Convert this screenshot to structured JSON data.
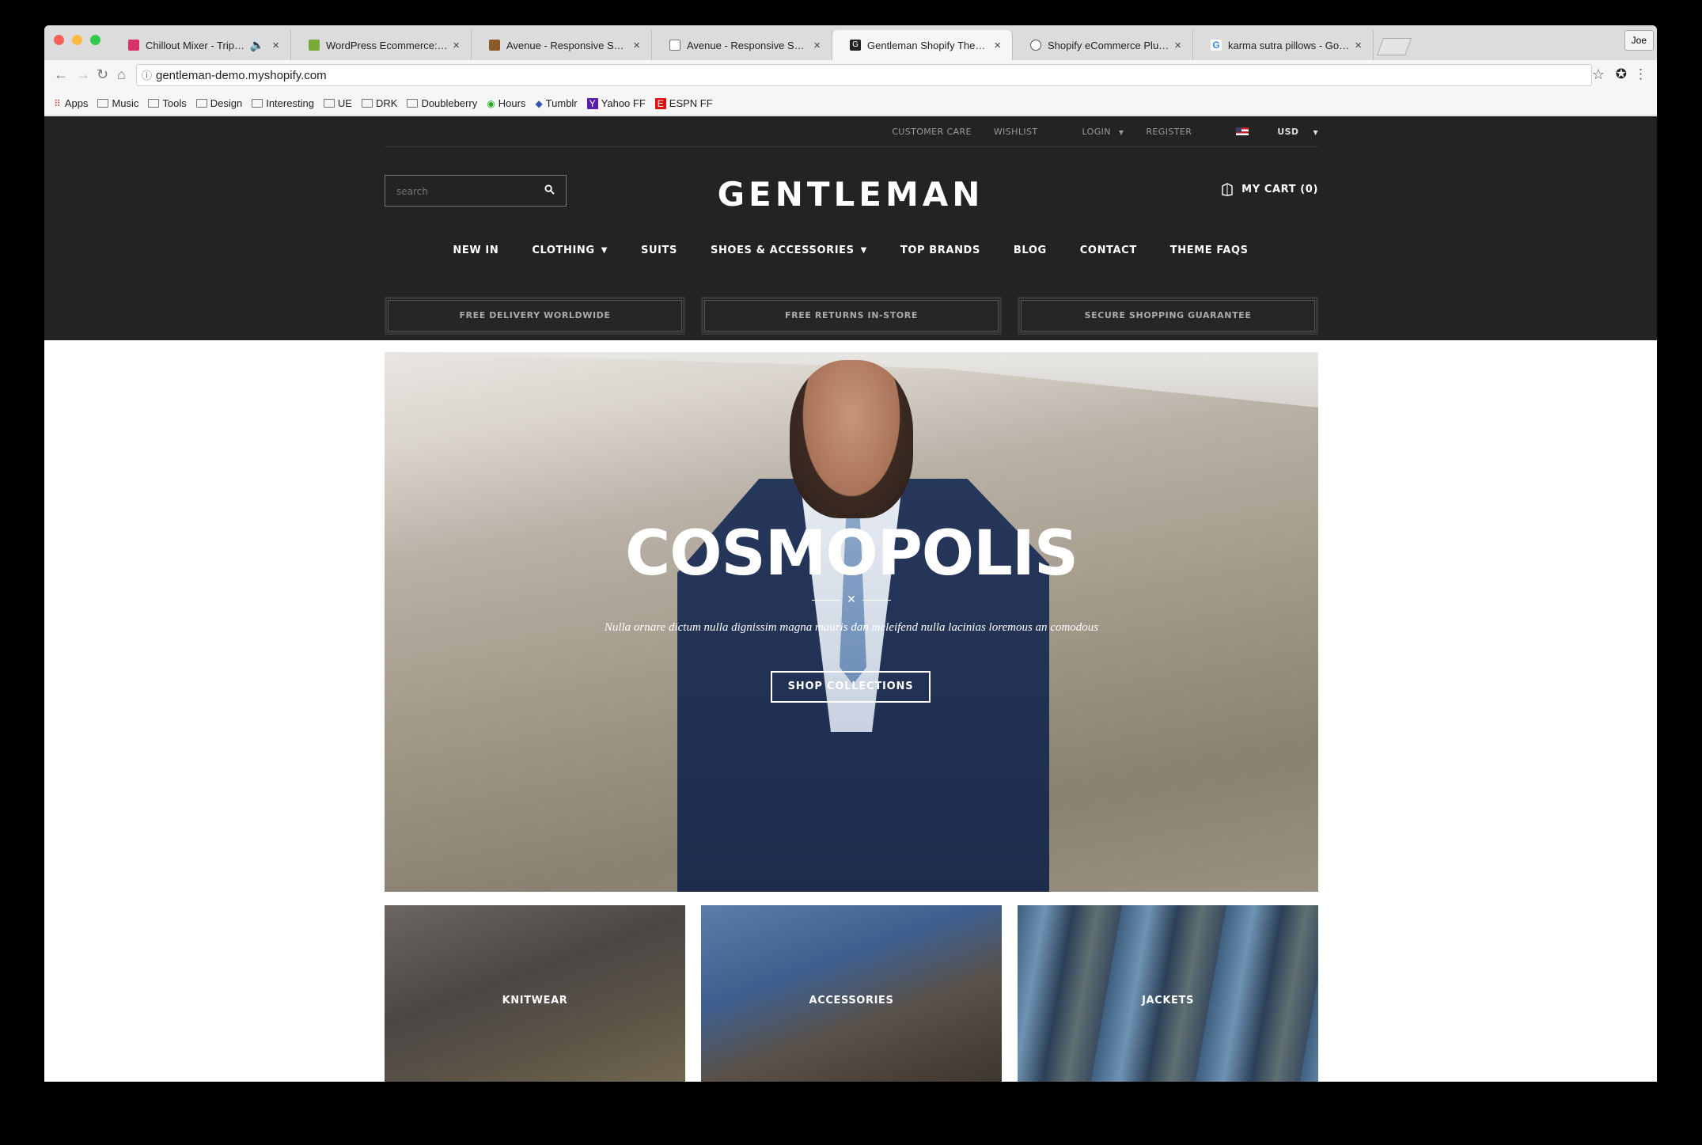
{
  "browser": {
    "tabs": [
      {
        "title": "Chillout Mixer - TripHop/Do",
        "fav_color": "#d6336c"
      },
      {
        "title": "WordPress Ecommerce: Sell o",
        "fav_color": "#7aa93c"
      },
      {
        "title": "Avenue - Responsive Shopify",
        "fav_color": "#8a5a2b"
      },
      {
        "title": "Avenue - Responsive Shopify",
        "fav_color": "#ffffff"
      },
      {
        "title": "Gentleman Shopify Theme",
        "fav_color": "#222222"
      },
      {
        "title": "Shopify eCommerce Plugin - S",
        "fav_color": "#555555"
      },
      {
        "title": "karma sutra pillows - Google S",
        "fav_color": "#4285f4"
      }
    ],
    "active_tab_index": 4,
    "profile_name": "Joe",
    "url": "gentleman-demo.myshopify.com",
    "bookmarks": [
      "Apps",
      "Music",
      "Tools",
      "Design",
      "Interesting",
      "UE",
      "DRK",
      "Doubleberry",
      "Hours",
      "Tumblr",
      "Yahoo FF",
      "ESPN FF"
    ]
  },
  "site": {
    "util_links": {
      "customer_care": "CUSTOMER CARE",
      "wishlist": "WISHLIST",
      "login": "LOGIN",
      "register": "REGISTER",
      "currency": "USD"
    },
    "search_placeholder": "search",
    "logo": "GENTLEMAN",
    "cart": "MY CART (0)",
    "nav": [
      "NEW IN",
      "CLOTHING",
      "SUITS",
      "SHOES & ACCESSORIES",
      "TOP BRANDS",
      "BLOG",
      "CONTACT",
      "THEME FAQS"
    ],
    "usps": [
      "FREE DELIVERY WORLDWIDE",
      "FREE RETURNS IN-STORE",
      "SECURE SHOPPING GUARANTEE"
    ],
    "hero": {
      "title": "COSMOPOLIS",
      "subtitle": "Nulla ornare dictum nulla dignissim magna mauris dan meleifend nulla lacinias loremous an comodous",
      "button": "SHOP COLLECTIONS"
    },
    "categories": [
      "KNITWEAR",
      "ACCESSORIES",
      "JACKETS"
    ]
  }
}
